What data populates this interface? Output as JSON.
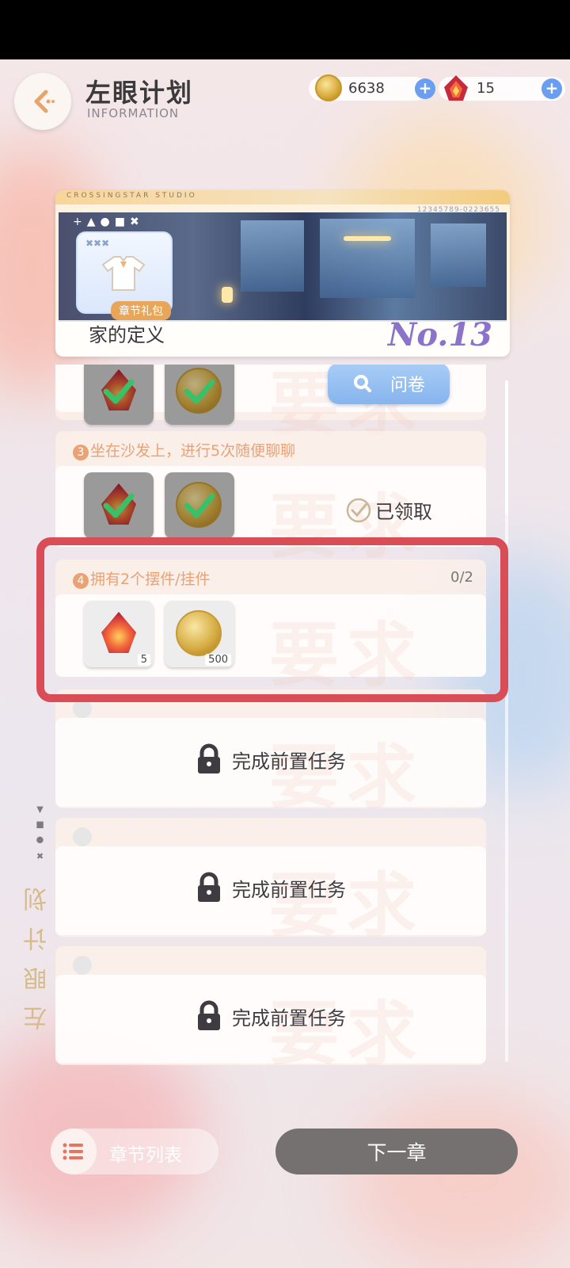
{
  "header": {
    "title": "左眼计划",
    "subtitle": "INFORMATION",
    "coins": "6638",
    "gems": "15"
  },
  "banner": {
    "studio": "CROSSINGSTAR STUDIO",
    "serial": "12345789-0223655",
    "gift_tag": "章节礼包",
    "chapter_name": "家的定义",
    "chapter_no": "No.13"
  },
  "tasks": {
    "t2": {
      "survey_label": "问卷"
    },
    "t3": {
      "title": "坐在沙发上，进行5次随便聊聊",
      "num": "3",
      "claimed_label": "已领取"
    },
    "t4": {
      "title": "拥有2个摆件/挂件",
      "num": "4",
      "progress": "0/2",
      "gem_qty": "5",
      "coin_qty": "500"
    },
    "locked_label": "完成前置任务"
  },
  "side": {
    "vertical_title": "左眼计划"
  },
  "footer": {
    "chapter_list": "章节列表",
    "next_chapter": "下一章"
  },
  "colors": {
    "highlight": "#d94d56",
    "accent_orange": "#e9a276",
    "survey_blue": "#86b4ee"
  }
}
